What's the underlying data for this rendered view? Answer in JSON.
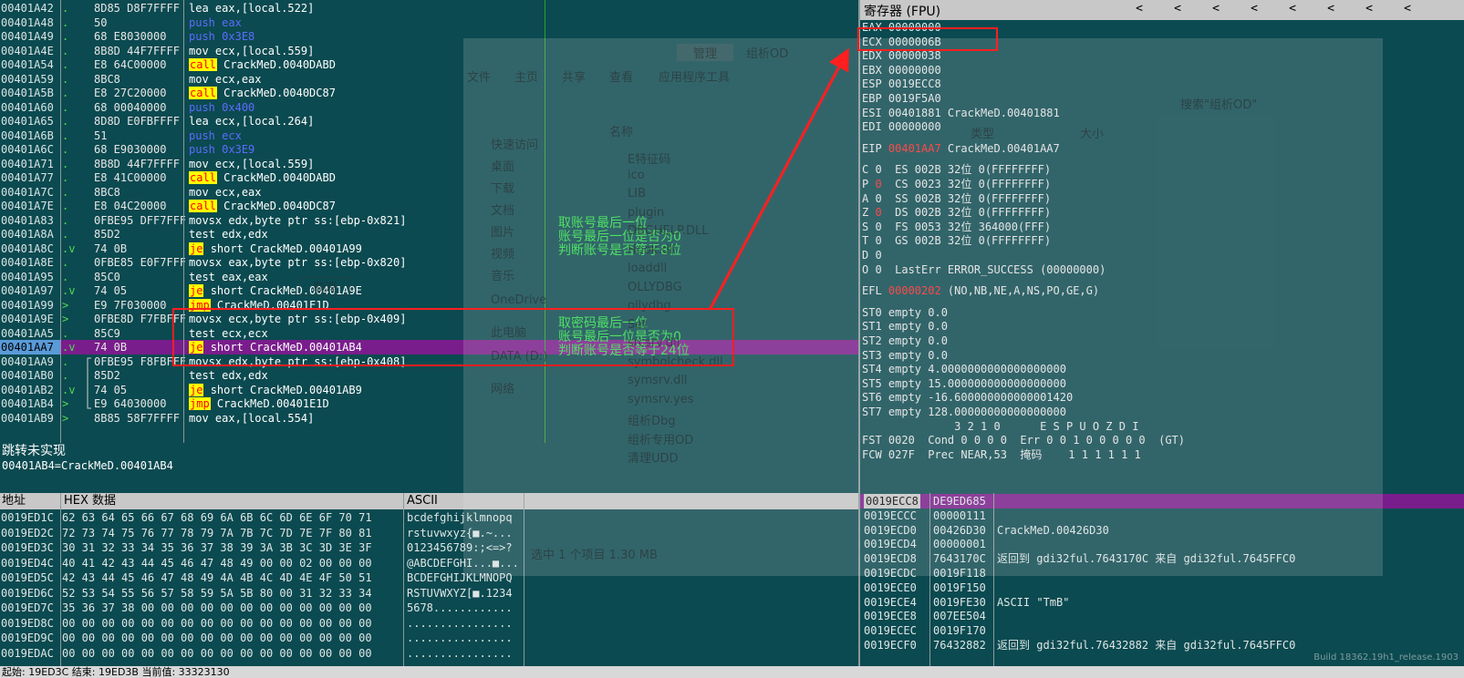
{
  "disasm": [
    {
      "addr": "00401A42",
      "mark": ".",
      "hex": "8D85 D8F7FFFF",
      "mn": "lea",
      "ops": "eax,[local.522]",
      "mcls": "lea"
    },
    {
      "addr": "00401A48",
      "mark": ".",
      "hex": "50",
      "mn": "push",
      "ops": "eax",
      "mcls": "push"
    },
    {
      "addr": "00401A49",
      "mark": ".",
      "hex": "68 E8030000",
      "mn": "push",
      "ops": "0x3E8",
      "mcls": "push"
    },
    {
      "addr": "00401A4E",
      "mark": ".",
      "hex": "8B8D 44F7FFFF",
      "mn": "mov",
      "ops": "ecx,[local.559]",
      "mcls": "mov"
    },
    {
      "addr": "00401A54",
      "mark": ".",
      "hex": "E8 64C00000",
      "mn": "call",
      "ops": "CrackMeD.0040DABD",
      "mcls": "call"
    },
    {
      "addr": "00401A59",
      "mark": ".",
      "hex": "8BC8",
      "mn": "mov",
      "ops": "ecx,eax",
      "mcls": "mov"
    },
    {
      "addr": "00401A5B",
      "mark": ".",
      "hex": "E8 27C20000",
      "mn": "call",
      "ops": "CrackMeD.0040DC87",
      "mcls": "call"
    },
    {
      "addr": "00401A60",
      "mark": ".",
      "hex": "68 00040000",
      "mn": "push",
      "ops": "0x400",
      "mcls": "push"
    },
    {
      "addr": "00401A65",
      "mark": ".",
      "hex": "8D8D E0FBFFFF",
      "mn": "lea",
      "ops": "ecx,[local.264]",
      "mcls": "lea"
    },
    {
      "addr": "00401A6B",
      "mark": ".",
      "hex": "51",
      "mn": "push",
      "ops": "ecx",
      "mcls": "push"
    },
    {
      "addr": "00401A6C",
      "mark": ".",
      "hex": "68 E9030000",
      "mn": "push",
      "ops": "0x3E9",
      "mcls": "push"
    },
    {
      "addr": "00401A71",
      "mark": ".",
      "hex": "8B8D 44F7FFFF",
      "mn": "mov",
      "ops": "ecx,[local.559]",
      "mcls": "mov"
    },
    {
      "addr": "00401A77",
      "mark": ".",
      "hex": "E8 41C00000",
      "mn": "call",
      "ops": "CrackMeD.0040DABD",
      "mcls": "call"
    },
    {
      "addr": "00401A7C",
      "mark": ".",
      "hex": "8BC8",
      "mn": "mov",
      "ops": "ecx,eax",
      "mcls": "mov"
    },
    {
      "addr": "00401A7E",
      "mark": ".",
      "hex": "E8 04C20000",
      "mn": "call",
      "ops": "CrackMeD.0040DC87",
      "mcls": "call"
    },
    {
      "addr": "00401A83",
      "mark": ".",
      "hex": "0FBE95 DFF7FFFF",
      "mn": "movsx",
      "ops": "edx,byte ptr ss:[ebp-0x821]",
      "mcls": "movsx"
    },
    {
      "addr": "00401A8A",
      "mark": ".",
      "hex": "85D2",
      "mn": "test",
      "ops": "edx,edx",
      "mcls": "test"
    },
    {
      "addr": "00401A8C",
      "mark": ".v",
      "hex": "74 0B",
      "mn": "je",
      "ops": "short CrackMeD.00401A99",
      "mcls": "je"
    },
    {
      "addr": "00401A8E",
      "mark": ".",
      "hex": "0FBE85 E0F7FFFF",
      "mn": "movsx",
      "ops": "eax,byte ptr ss:[ebp-0x820]",
      "mcls": "movsx"
    },
    {
      "addr": "00401A95",
      "mark": ".",
      "hex": "85C0",
      "mn": "test",
      "ops": "eax,eax",
      "mcls": "test"
    },
    {
      "addr": "00401A97",
      "mark": ".v",
      "hex": "74 05",
      "mn": "je",
      "ops": "short CrackMeD.00401A9E",
      "mcls": "je"
    },
    {
      "addr": "00401A99",
      "mark": ">",
      "hex": "E9 7F030000",
      "mn": "jmp",
      "ops": "CrackMeD.00401E1D",
      "mcls": "jmp"
    },
    {
      "addr": "00401A9E",
      "mark": ">",
      "hex": "0FBE8D F7FBFFFF",
      "mn": "movsx",
      "ops": "ecx,byte ptr ss:[ebp-0x409]",
      "mcls": "movsx"
    },
    {
      "addr": "00401AA5",
      "mark": ".",
      "hex": "85C9",
      "mn": "test",
      "ops": "ecx,ecx",
      "mcls": "test"
    },
    {
      "addr": "00401AA7",
      "mark": ".v",
      "hex": "74 0B",
      "mn": "je",
      "ops": "short CrackMeD.00401AB4",
      "mcls": "je",
      "sel": true
    },
    {
      "addr": "00401AA9",
      "mark": ".",
      "hex": "0FBE95 F8FBFFFF",
      "mn": "movsx",
      "ops": "edx,byte ptr ss:[ebp-0x408]",
      "mcls": "movsx"
    },
    {
      "addr": "00401AB0",
      "mark": ".",
      "hex": "85D2",
      "mn": "test",
      "ops": "edx,edx",
      "mcls": "test"
    },
    {
      "addr": "00401AB2",
      "mark": ".v",
      "hex": "74 05",
      "mn": "je",
      "ops": "short CrackMeD.00401AB9",
      "mcls": "je"
    },
    {
      "addr": "00401AB4",
      "mark": ">",
      "hex": "E9 64030000",
      "mn": "jmp",
      "ops": "CrackMeD.00401E1D",
      "mcls": "jmp"
    },
    {
      "addr": "00401AB9",
      "mark": ">",
      "hex": "8B85 58F7FFFF",
      "mn": "mov",
      "ops": "eax,[local.554]",
      "mcls": "mov"
    }
  ],
  "annotations": {
    "a1": [
      "取账号最后一位",
      "账号最后一位是否为0",
      "判断账号是否等于8位"
    ],
    "a2": [
      "取密码最后一位",
      "账号最后一位是否为0",
      "判断账号是否等于24位"
    ]
  },
  "info": {
    "line1": "跳转未实现",
    "line2": "00401AB4=CrackMeD.00401AB4"
  },
  "dump": {
    "head_addr": "地址",
    "head_hex": "HEX 数据",
    "head_ascii": "ASCII",
    "rows": [
      {
        "addr": "0019ED1C",
        "hex": "62 63 64 65 66 67 68 69 6A 6B 6C 6D 6E 6F 70 71",
        "ascii": "bcdefghijklmnopq"
      },
      {
        "addr": "0019ED2C",
        "hex": "72 73 74 75 76 77 78 79 7A 7B 7C 7D 7E 7F 80 81",
        "ascii": "rstuvwxyz{■.~..."
      },
      {
        "addr": "0019ED3C",
        "hex": "30 31 32 33 34 35 36 37 38 39 3A 3B 3C 3D 3E 3F",
        "ascii": "0123456789:;<=>?"
      },
      {
        "addr": "0019ED4C",
        "hex": "40 41 42 43 44 45 46 47 48 49 00 00 02 00 00 00",
        "ascii": "@ABCDEFGHI...■..."
      },
      {
        "addr": "0019ED5C",
        "hex": "42 43 44 45 46 47 48 49 4A 4B 4C 4D 4E 4F 50 51",
        "ascii": "BCDEFGHIJKLMNOPQ"
      },
      {
        "addr": "0019ED6C",
        "hex": "52 53 54 55 56 57 58 59 5A 5B 80 00 31 32 33 34",
        "ascii": "RSTUVWXYZ[■.1234"
      },
      {
        "addr": "0019ED7C",
        "hex": "35 36 37 38 00 00 00 00 00 00 00 00 00 00 00 00",
        "ascii": "5678............"
      },
      {
        "addr": "0019ED8C",
        "hex": "00 00 00 00 00 00 00 00 00 00 00 00 00 00 00 00",
        "ascii": "................"
      },
      {
        "addr": "0019ED9C",
        "hex": "00 00 00 00 00 00 00 00 00 00 00 00 00 00 00 00",
        "ascii": "................"
      },
      {
        "addr": "0019EDAC",
        "hex": "00 00 00 00 00 00 00 00 00 00 00 00 00 00 00 00",
        "ascii": "................"
      }
    ]
  },
  "regs": {
    "title": "寄存器 (FPU)",
    "arrows": [
      "<",
      "<",
      "<",
      "<",
      "<",
      "<",
      "<",
      "<"
    ],
    "lines": [
      {
        "t": "EAX 00000000"
      },
      {
        "t": "ECX 0000006B"
      },
      {
        "t": "EDX 00000038"
      },
      {
        "t": "EBX 00000000"
      },
      {
        "t": "ESP 0019ECC8"
      },
      {
        "t": "EBP 0019F5A0"
      },
      {
        "t": "ESI 00401881 CrackMeD.00401881"
      },
      {
        "t": "EDI 00000000"
      },
      {
        "t": ""
      },
      {
        "pre": "EIP ",
        "red": "00401AA7",
        "post": " CrackMeD.00401AA7"
      },
      {
        "t": ""
      },
      {
        "t": "C 0  ES 002B 32位 0(FFFFFFFF)"
      },
      {
        "pre": "P ",
        "red": "0",
        "post": "  CS 0023 32位 0(FFFFFFFF)"
      },
      {
        "t": "A 0  SS 002B 32位 0(FFFFFFFF)"
      },
      {
        "pre": "Z ",
        "red": "0",
        "post": "  DS 002B 32位 0(FFFFFFFF)"
      },
      {
        "t": "S 0  FS 0053 32位 364000(FFF)"
      },
      {
        "t": "T 0  GS 002B 32位 0(FFFFFFFF)"
      },
      {
        "t": "D 0"
      },
      {
        "t": "O 0  LastErr ERROR_SUCCESS (00000000)"
      },
      {
        "t": ""
      },
      {
        "pre": "EFL ",
        "red": "00000202",
        "post": " (NO,NB,NE,A,NS,PO,GE,G)"
      },
      {
        "t": ""
      },
      {
        "t": "ST0 empty 0.0"
      },
      {
        "t": "ST1 empty 0.0"
      },
      {
        "t": "ST2 empty 0.0"
      },
      {
        "t": "ST3 empty 0.0"
      },
      {
        "t": "ST4 empty 4.0000000000000000000"
      },
      {
        "t": "ST5 empty 15.000000000000000000"
      },
      {
        "t": "ST6 empty -16.600000000000001420"
      },
      {
        "t": "ST7 empty 128.00000000000000000"
      },
      {
        "t": "              3 2 1 0      E S P U O Z D I"
      },
      {
        "t": "FST 0020  Cond 0 0 0 0  Err 0 0 1 0 0 0 0 0  (GT)"
      },
      {
        "t": "FCW 027F  Prec NEAR,53  掩码    1 1 1 1 1 1"
      }
    ]
  },
  "stack": [
    {
      "addr": "0019ECC8",
      "val": "DE9ED685",
      "com": ""
    },
    {
      "addr": "0019ECCC",
      "val": "00000111",
      "com": ""
    },
    {
      "addr": "0019ECD0",
      "val": "00426D30",
      "com": "CrackMeD.00426D30"
    },
    {
      "addr": "0019ECD4",
      "val": "00000001",
      "com": ""
    },
    {
      "addr": "0019ECD8",
      "val": "7643170C",
      "com": "返回到 gdi32ful.7643170C 来自 gdi32ful.7645FFC0"
    },
    {
      "addr": "0019ECDC",
      "val": "0019F118",
      "com": ""
    },
    {
      "addr": "0019ECE0",
      "val": "0019F150",
      "com": ""
    },
    {
      "addr": "0019ECE4",
      "val": "0019FE30",
      "com": "ASCII \"TmB\""
    },
    {
      "addr": "0019ECE8",
      "val": "007EE504",
      "com": ""
    },
    {
      "addr": "0019ECEC",
      "val": "0019F170",
      "com": ""
    },
    {
      "addr": "0019ECF0",
      "val": "76432882",
      "com": "返回到 gdi32ful.76432882 来自 gdi32ful.7645FFC0"
    }
  ],
  "status": "起始: 19ED3C 结束: 19ED3B 当前值: 33323130",
  "ghost": {
    "ribbon": [
      "文件",
      "主页",
      "共享",
      "查看",
      "应用程序工具"
    ],
    "manage": "管理",
    "folder": "组析OD",
    "search": "搜索\"组析OD\"",
    "nav": [
      "快速访问",
      "桌面",
      "下载",
      "文档",
      "图片",
      "视频",
      "音乐",
      "OneDrive",
      "此电脑",
      "DATA (D:)",
      "网络"
    ],
    "files": [
      "E特征码",
      "ico",
      "LIB",
      "plugin",
      "DBGHELP.DLL",
      "Hook.dll",
      "loaddll",
      "OLLYDBG",
      "ollydbg",
      "Set",
      "srcsrv.dll",
      "symbolcheck.dll",
      "symsrv.dll",
      "symsrv.yes",
      "组析Dbg",
      "组析专用OD",
      "清理UDD"
    ],
    "col_name": "名称",
    "col_type": "类型",
    "col_size": "大小",
    "selected": "选中 1 个项目  1.30 MB",
    "dialog_btn": "取消"
  },
  "watermark": "Build 18362.19h1_release.1903"
}
